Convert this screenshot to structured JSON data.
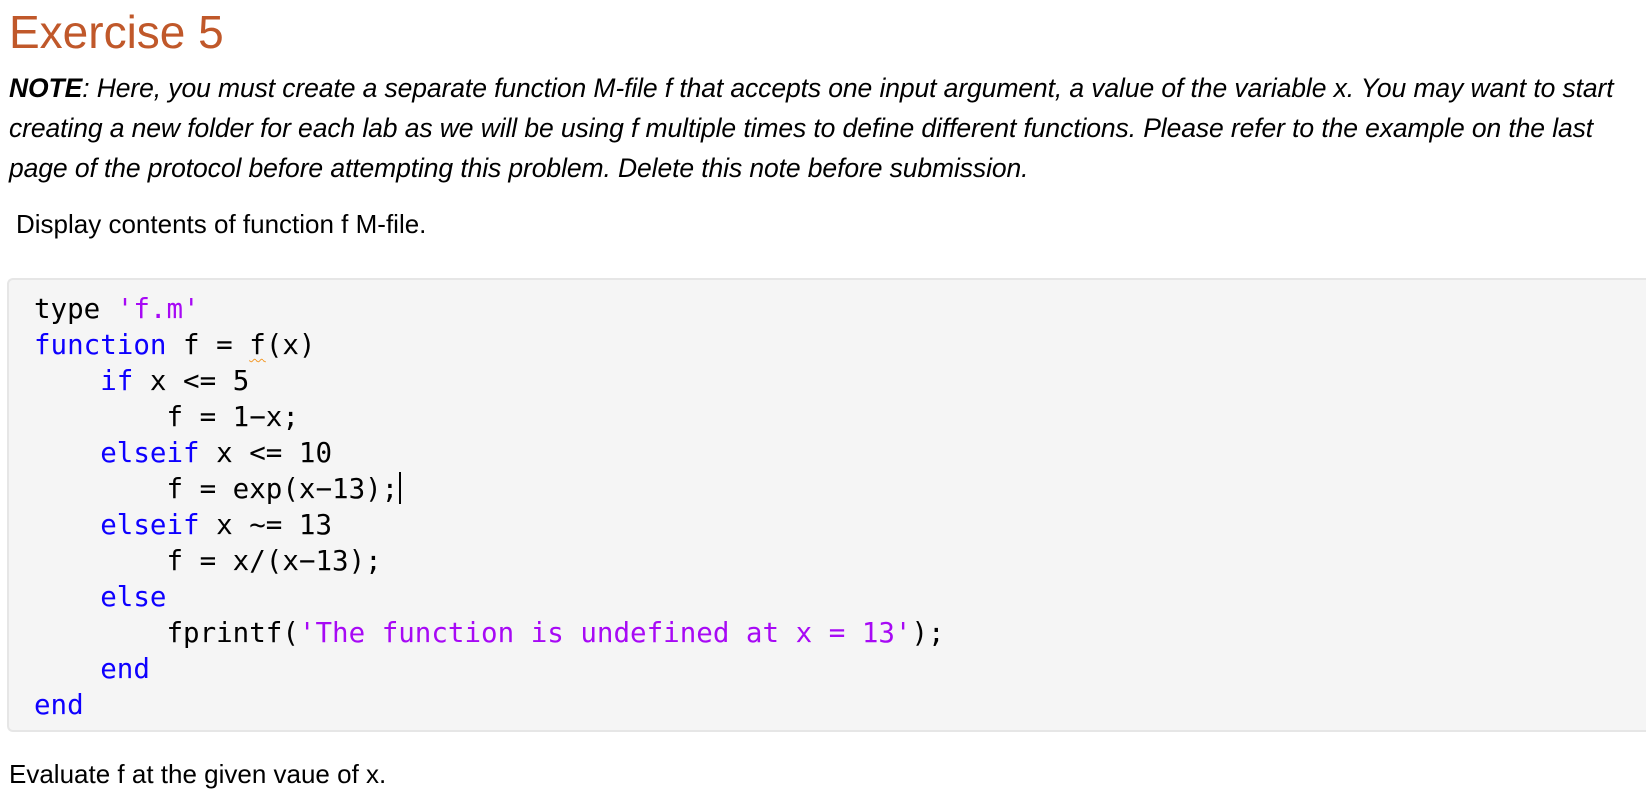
{
  "section": {
    "title": "Exercise 5"
  },
  "note": {
    "label": "NOTE",
    "text": ": Here, you must create a separate function M-file f that accepts one input argument, a value of the variable x. You may want to start creating a new folder for each lab as we will be using f multiple times to define different functions. Please refer to the example on the last page of the protocol before attempting this problem.  Delete this note before submission."
  },
  "instruction_1": "Display contents of function f M-file.",
  "code": {
    "line1": {
      "cmd": "type ",
      "arg": "'f.m'"
    },
    "line2": {
      "kw": "function",
      "pre": " f = ",
      "fname": "f",
      "post": "(x)"
    },
    "line3": {
      "indent": "    ",
      "kw": "if",
      "rest": " x <= 5"
    },
    "line4": {
      "text": "        f = 1−x;"
    },
    "line5": {
      "indent": "    ",
      "kw": "elseif",
      "rest": " x <= 10"
    },
    "line6": {
      "text": "        f = exp(x−13);"
    },
    "line7": {
      "indent": "    ",
      "kw": "elseif",
      "rest": " x ~= 13"
    },
    "line8": {
      "text": "        f = x/(x−13);"
    },
    "line9": {
      "indent": "    ",
      "kw": "else"
    },
    "line10": {
      "pre": "        fprintf(",
      "str": "'The function is undefined at x = 13'",
      "post": ");"
    },
    "line11": {
      "indent": "    ",
      "kw": "end"
    },
    "line12": {
      "kw": "end"
    }
  },
  "instruction_2": "Evaluate f at the given vaue of x.",
  "colors": {
    "title": "#c0582a",
    "keyword": "#0e00ff",
    "string": "#a709f5",
    "code_background": "#f5f5f5"
  }
}
